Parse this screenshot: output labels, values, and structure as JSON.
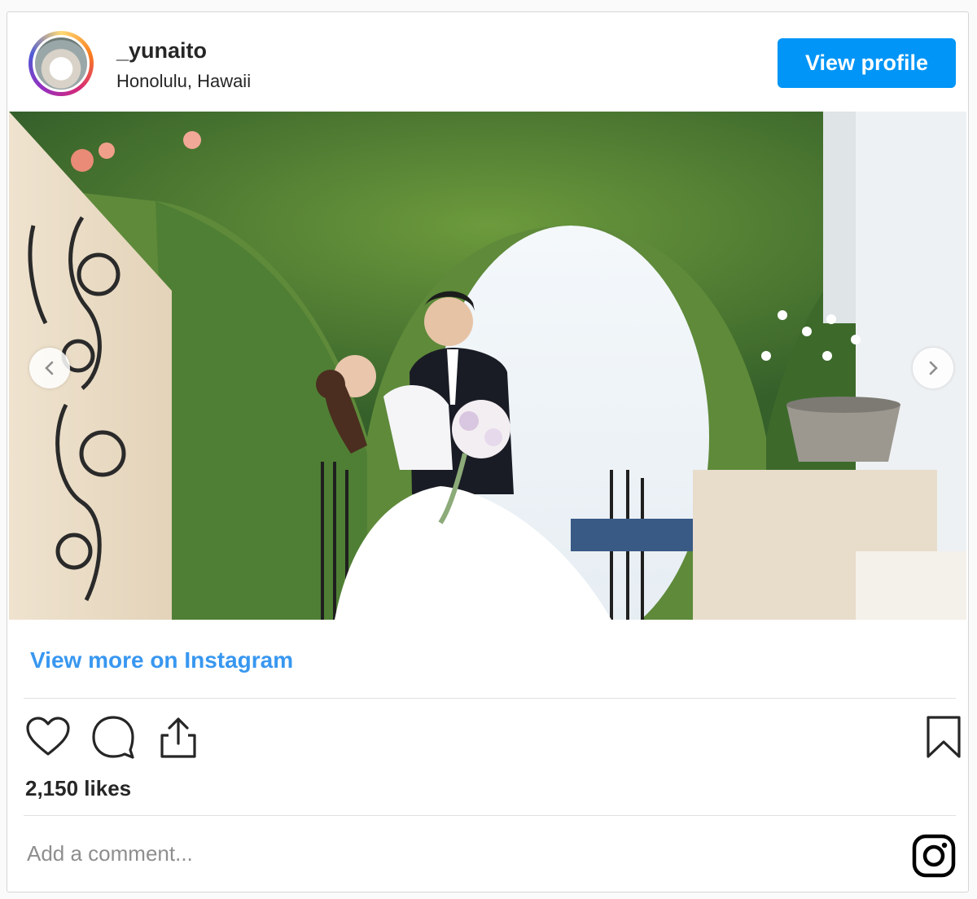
{
  "header": {
    "username": "_yunaito",
    "location": "Honolulu, Hawaii",
    "view_profile_label": "View profile"
  },
  "media": {
    "carousel_dots": 3,
    "active_dot": 2
  },
  "links": {
    "view_more": "View more on Instagram"
  },
  "actions": {
    "icons": [
      "heart-icon",
      "comment-icon",
      "share-icon",
      "bookmark-icon"
    ]
  },
  "stats": {
    "likes": "2,150 likes"
  },
  "comment": {
    "placeholder": "Add a comment..."
  },
  "colors": {
    "accent": "#0095f6",
    "link": "#3897f0",
    "text": "#262626",
    "muted": "#8e8e8e"
  }
}
